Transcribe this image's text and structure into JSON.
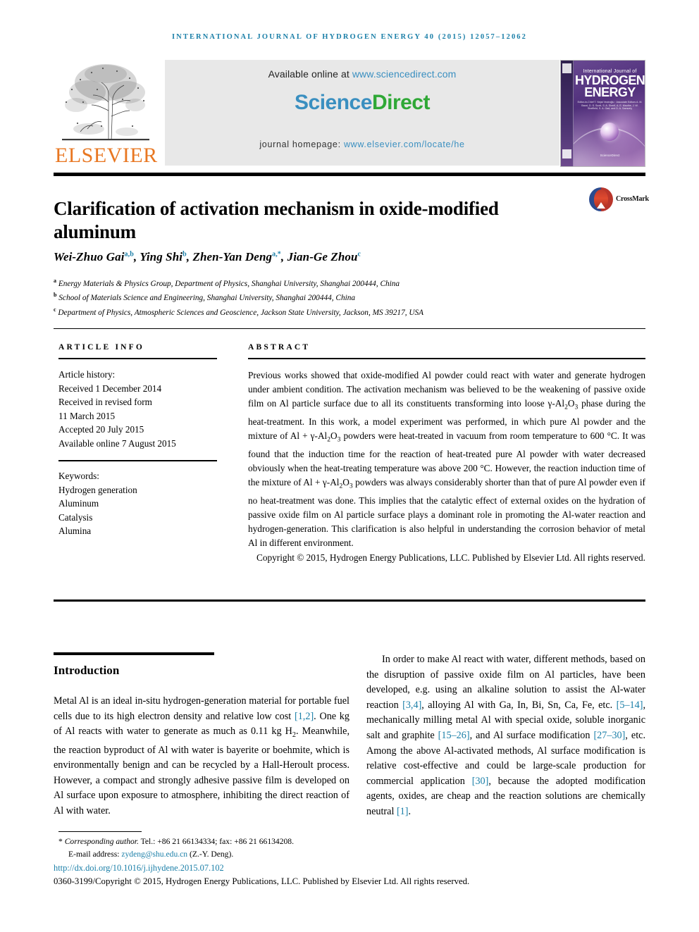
{
  "running_head": "International Journal of Hydrogen Energy 40 (2015) 12057–12062",
  "masthead": {
    "publisher_name": "ELSEVIER",
    "available_prefix": "Available online at ",
    "available_link": "www.sciencedirect.com",
    "brand_first": "Science",
    "brand_second": "Direct",
    "homepage_prefix": "journal homepage: ",
    "homepage_link": "www.elsevier.com/locate/he",
    "cover": {
      "line_small": "International Journal of",
      "line_big_1": "HYDROGEN",
      "line_big_2": "ENERGY",
      "editors": "Editor-in-Chief  T. Nejat Veziroğlu  ·  Associate Editors  A. M. Bazzi, D. S. Scott, S. A. Sherif, A. E. Mauthe, J. W. Sheffield, S. A. Gad, and D. A. Samuely",
      "sciencedirect": "ScienceDirect"
    }
  },
  "article": {
    "title": "Clarification of activation mechanism in oxide-modified aluminum",
    "crossmark_label": "CrossMark",
    "authors": [
      {
        "name": "Wei-Zhuo Gai",
        "sup": "a,b"
      },
      {
        "name": "Ying Shi",
        "sup": "b"
      },
      {
        "name": "Zhen-Yan Deng",
        "sup": "a,*"
      },
      {
        "name": "Jian-Ge Zhou",
        "sup": "c"
      }
    ],
    "affiliations": [
      {
        "marker": "a",
        "text": "Energy Materials & Physics Group, Department of Physics, Shanghai University, Shanghai 200444, China"
      },
      {
        "marker": "b",
        "text": "School of Materials Science and Engineering, Shanghai University, Shanghai 200444, China"
      },
      {
        "marker": "c",
        "text": "Department of Physics, Atmospheric Sciences and Geoscience, Jackson State University, Jackson, MS 39217, USA"
      }
    ]
  },
  "article_info": {
    "heading": "ARTICLE INFO",
    "history_label": "Article history:",
    "history": [
      "Received 1 December 2014",
      "Received in revised form",
      "11 March 2015",
      "Accepted 20 July 2015",
      "Available online 7 August 2015"
    ],
    "keywords_label": "Keywords:",
    "keywords": [
      "Hydrogen generation",
      "Aluminum",
      "Catalysis",
      "Alumina"
    ]
  },
  "abstract": {
    "heading": "ABSTRACT",
    "text_part_1": "Previous works showed that oxide-modified Al powder could react with water and generate hydrogen under ambient condition. The activation mechanism was believed to be the weakening of passive oxide film on Al particle surface due to all its constituents transforming into loose γ-Al",
    "text_part_2": "O",
    "text_part_3": " phase during the heat-treatment. In this work, a model experiment was performed, in which pure Al powder and the mixture of Al + γ-Al",
    "text_part_4": "O",
    "text_part_5": " powders were heat-treated in vacuum from room temperature to 600 °C. It was found that the induction time for the reaction of heat-treated pure Al powder with water decreased obviously when the heat-treating temperature was above 200 °C. However, the reaction induction time of the mixture of Al + γ-Al",
    "text_part_6": "O",
    "text_part_7": " powders was always considerably shorter than that of pure Al powder even if no heat-treatment was done. This implies that the catalytic effect of external oxides on the hydration of passive oxide film on Al particle surface plays a dominant role in promoting the Al-water reaction and hydrogen-generation. This clarification is also helpful in understanding the corrosion behavior of metal Al in different environment.",
    "copyright": "Copyright © 2015, Hydrogen Energy Publications, LLC. Published by Elsevier Ltd. All rights reserved."
  },
  "introduction": {
    "heading": "Introduction",
    "left_paragraph": {
      "p1": "Metal Al is an ideal in-situ hydrogen-generation material for portable fuel cells due to its high electron density and relative low cost ",
      "r1": "[1,2]",
      "p2": ". One kg of Al reacts with water to generate as much as 0.11 kg H",
      "sub1": "2",
      "p3": ". Meanwhile, the reaction byproduct of Al with water is bayerite or boehmite, which is environmentally benign and can be recycled by a Hall-Heroult process. However, a compact and strongly adhesive passive film is developed on Al surface upon exposure to atmosphere, inhibiting the direct reaction of Al with water."
    },
    "right_paragraph": {
      "p1": "In order to make Al react with water, different methods, based on the disruption of passive oxide film on Al particles, have been developed, e.g. using an alkaline solution to assist the Al-water reaction ",
      "r1": "[3,4]",
      "p2": ", alloying Al with Ga, In, Bi, Sn, Ca, Fe, etc. ",
      "r2": "[5–14]",
      "p3": ", mechanically milling metal Al with special oxide, soluble inorganic salt and graphite ",
      "r3": "[15–26]",
      "p4": ", and Al surface modification ",
      "r4": "[27–30]",
      "p5": ", etc. Among the above Al-activated methods, Al surface modification is relative cost-effective and could be large-scale production for commercial application ",
      "r5": "[30]",
      "p6": ", because the adopted modification agents, oxides, are cheap and the reaction solutions are chemically neutral ",
      "r6": "[1]",
      "p7": "."
    }
  },
  "footer": {
    "corresponding_label": "Corresponding author.",
    "corresponding_rest": " Tel.: +86 21 66134334; fax: +86 21 66134208.",
    "email_label": "E-mail address: ",
    "email": "zydeng@shu.edu.cn",
    "email_suffix": " (Z.-Y. Deng).",
    "doi": "http://dx.doi.org/10.1016/j.ijhydene.2015.07.102",
    "issn_line": "0360-3199/Copyright © 2015, Hydrogen Energy Publications, LLC. Published by Elsevier Ltd. All rights reserved."
  },
  "colors": {
    "link": "#1b7fa8",
    "elsevier_orange": "#e87722",
    "sciencedirect_blue": "#3a8fc0",
    "sciencedirect_green": "#2fa836",
    "cover_purple": "#4f2f7a"
  }
}
